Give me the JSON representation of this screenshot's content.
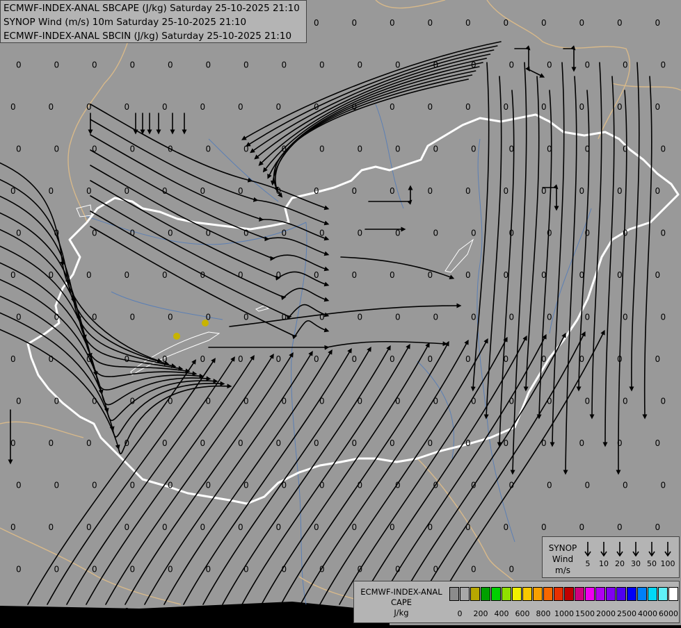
{
  "map_titles": {
    "line1": "ECMWF-INDEX-ANAL SBCAPE (J/kg) Saturday 25-10-2025 21:10",
    "line2": "SYNOP Wind (m/s) 10m Saturday 25-10-2025 21:10",
    "line3": "ECMWF-INDEX-ANAL SBCIN (J/kg) Saturday 25-10-2025 21:10"
  },
  "field_value_label": "0",
  "colors": {
    "map_background": "#999999",
    "country_border": "#ffffff",
    "neighbour_border": "#d8b98a",
    "rivers": "#5b7fb5",
    "streamlines": "#000000",
    "cape_points": "#c8b400",
    "legend_background": "#b4b4b4"
  },
  "synop_legend": {
    "title_line1": "SYNOP",
    "title_line2": "Wind",
    "title_line3": "m/s",
    "speeds": [
      "5",
      "10",
      "20",
      "30",
      "50",
      "100"
    ]
  },
  "cape_legend": {
    "title_line1": "ECMWF-INDEX-ANAL",
    "title_line2": "CAPE",
    "title_line3": "J/kg",
    "swatch_colors": [
      "#8c8c8c",
      "#a8a8a8",
      "#b8a800",
      "#00a000",
      "#00d000",
      "#90e000",
      "#f0f000",
      "#f8c800",
      "#f8a000",
      "#f86800",
      "#e83000",
      "#c00000",
      "#d00080",
      "#f000f0",
      "#b000f0",
      "#8000f0",
      "#5000f0",
      "#0000f8",
      "#0080f8",
      "#00d8f8",
      "#60f0f8",
      "#ffffff"
    ],
    "tick_labels": [
      "0",
      "200",
      "400",
      "600",
      "800",
      "1000",
      "1500",
      "2000",
      "2500",
      "4000",
      "6000"
    ]
  }
}
